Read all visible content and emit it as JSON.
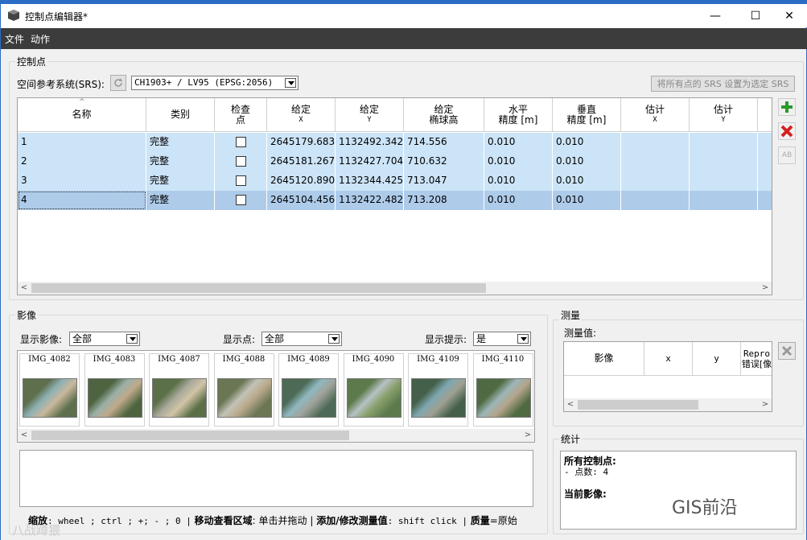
{
  "window": {
    "title": "控制点编辑器*",
    "minimize": "—",
    "maximize": "☐",
    "close": "✕"
  },
  "menu": {
    "file": "文件",
    "action": "动作"
  },
  "gcp_group": {
    "label": "控制点",
    "srs_label": "空间参考系统(SRS):",
    "srs_value": "CH1903+ / LV95 (EPSG:2056)",
    "set_srs_button": "将所有点的 SRS 设置为选定 SRS",
    "columns": [
      {
        "l1": "名称",
        "l2": ""
      },
      {
        "l1": "类别",
        "l2": ""
      },
      {
        "l1": "检查",
        "l2": "点"
      },
      {
        "l1": "给定",
        "l2": "X"
      },
      {
        "l1": "给定",
        "l2": "Y"
      },
      {
        "l1": "给定",
        "l2": "椭球高"
      },
      {
        "l1": "水平",
        "l2": "精度 [m]"
      },
      {
        "l1": "垂直",
        "l2": "精度 [m]"
      },
      {
        "l1": "估计",
        "l2": "X"
      },
      {
        "l1": "估计",
        "l2": "Y"
      }
    ],
    "rows": [
      {
        "name": "1",
        "category": "完整",
        "x": "2645179.683",
        "y": "1132492.342",
        "h": "714.556",
        "hacc": "0.010",
        "vacc": "0.010"
      },
      {
        "name": "2",
        "category": "完整",
        "x": "2645181.267",
        "y": "1132427.704",
        "h": "710.632",
        "hacc": "0.010",
        "vacc": "0.010"
      },
      {
        "name": "3",
        "category": "完整",
        "x": "2645120.890",
        "y": "1132344.425",
        "h": "713.047",
        "hacc": "0.010",
        "vacc": "0.010"
      },
      {
        "name": "4",
        "category": "完整",
        "x": "2645104.456",
        "y": "1132422.482",
        "h": "713.208",
        "hacc": "0.010",
        "vacc": "0.010"
      }
    ],
    "add_icon": "plus-icon",
    "delete_icon": "delete-icon",
    "rename_icon": "rename-icon"
  },
  "images_group": {
    "label": "影像",
    "show_images_label": "显示影像:",
    "show_images_value": "全部",
    "show_points_label": "显示点:",
    "show_points_value": "全部",
    "show_hints_label": "显示提示:",
    "show_hints_value": "是",
    "thumbnails": [
      "IMG_4082",
      "IMG_4083",
      "IMG_4087",
      "IMG_4088",
      "IMG_4089",
      "IMG_4090",
      "IMG_4109",
      "IMG_4110"
    ]
  },
  "measure_group": {
    "label": "测量",
    "values_label": "测量值:",
    "columns": [
      "影像",
      "x",
      "y",
      "Repro",
      "错误[像"
    ]
  },
  "stats_group": {
    "label": "统计",
    "all_gcp": "所有控制点:",
    "point_count": "- 点数: 4",
    "current_image": "当前影像:"
  },
  "status": {
    "zoom_label": "缩放",
    "zoom_keys": ": wheel ; ctrl ; +; - ; 0 |",
    "move_label": "移动查看区域",
    "move_text": ": 单击并拖动 |",
    "add_label": "添加/修改测量值",
    "add_text": ": shift click |",
    "quality_label": "质量",
    "quality_text": "=原始"
  },
  "watermark": {
    "left": "八战蹲猥",
    "right": "GIS前沿"
  },
  "colors": {
    "row_bg": "#cce4f7",
    "row_selected": "#aecbea",
    "accent": "#2b6cc4",
    "menubar": "#3c3c3c"
  }
}
